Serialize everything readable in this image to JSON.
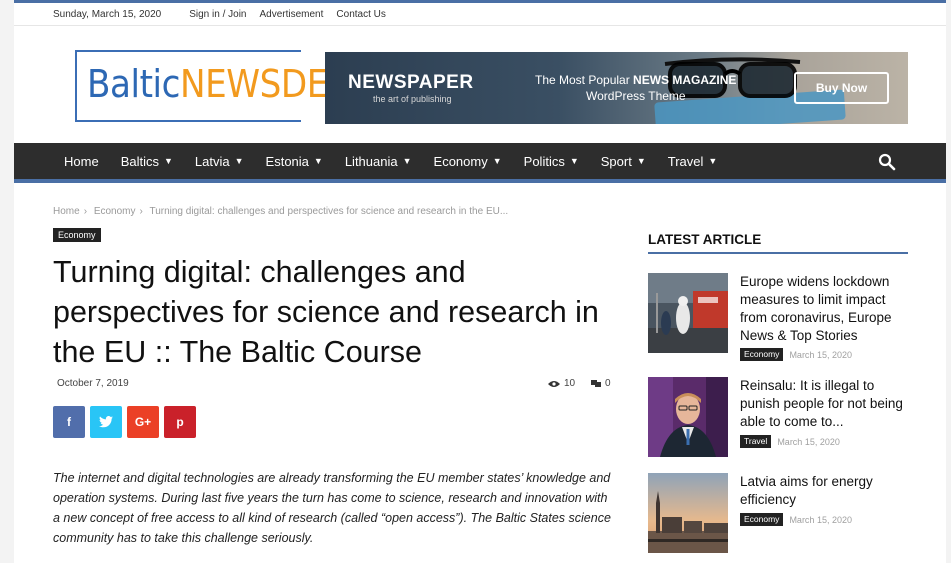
{
  "topbar": {
    "date": "Sunday, March 15, 2020",
    "links": [
      "Sign in / Join",
      "Advertisement",
      "Contact Us"
    ]
  },
  "logo": {
    "part1": "Baltic",
    "part2": "NEWSDESK"
  },
  "banner": {
    "title": "NEWSPAPER",
    "subtitle": "the art of publishing",
    "tagline_prefix": "The Most Popular ",
    "tagline_bold": "NEWS MAGAZINE",
    "tagline_line2": "WordPress Theme",
    "button": "Buy Now"
  },
  "nav": {
    "items": [
      {
        "label": "Home",
        "dropdown": false
      },
      {
        "label": "Baltics",
        "dropdown": true
      },
      {
        "label": "Latvia",
        "dropdown": true
      },
      {
        "label": "Estonia",
        "dropdown": true
      },
      {
        "label": "Lithuania",
        "dropdown": true
      },
      {
        "label": "Economy",
        "dropdown": true
      },
      {
        "label": "Politics",
        "dropdown": true
      },
      {
        "label": "Sport",
        "dropdown": true
      },
      {
        "label": "Travel",
        "dropdown": true
      }
    ],
    "search_icon": "search-icon"
  },
  "breadcrumb": [
    "Home",
    "Economy",
    "Turning digital: challenges and perspectives for science and research in the EU..."
  ],
  "article": {
    "category": "Economy",
    "title": "Turning digital: challenges and perspectives for science and research in the EU :: The Baltic Course",
    "date": "October 7, 2019",
    "views": "10",
    "comments": "0",
    "share": [
      {
        "icon": "facebook-icon",
        "glyph": "f",
        "color": "#516eab"
      },
      {
        "icon": "twitter-icon",
        "glyph": "t",
        "color": "#29c5f6"
      },
      {
        "icon": "googleplus-icon",
        "glyph": "G+",
        "color": "#eb4026"
      },
      {
        "icon": "pinterest-icon",
        "glyph": "p",
        "color": "#ca212a"
      }
    ],
    "excerpt": "The internet and digital technologies are already transforming the EU member states’ knowledge and operation systems. During last five years the turn has come to science, research and innovation with a new concept of free access to all kind of research (called “open access”). The Baltic States science community has to take this challenge seriously."
  },
  "sidebar": {
    "title": "LATEST ARTICLE",
    "items": [
      {
        "title": "Europe widens lockdown measures to limit impact from coronavirus, Europe News & Top Stories",
        "category": "Economy",
        "date": "March 15, 2020"
      },
      {
        "title": "Reinsalu: It is illegal to punish people for not being able to come to...",
        "category": "Travel",
        "date": "March 15, 2020"
      },
      {
        "title": "Latvia aims for energy efficiency",
        "category": "Economy",
        "date": "March 15, 2020"
      }
    ]
  },
  "colors": {
    "accent": "#4a6fa5",
    "nav_bg": "#2d2d2d",
    "logo_blue": "#2d68b4",
    "logo_orange": "#f29a1e"
  }
}
